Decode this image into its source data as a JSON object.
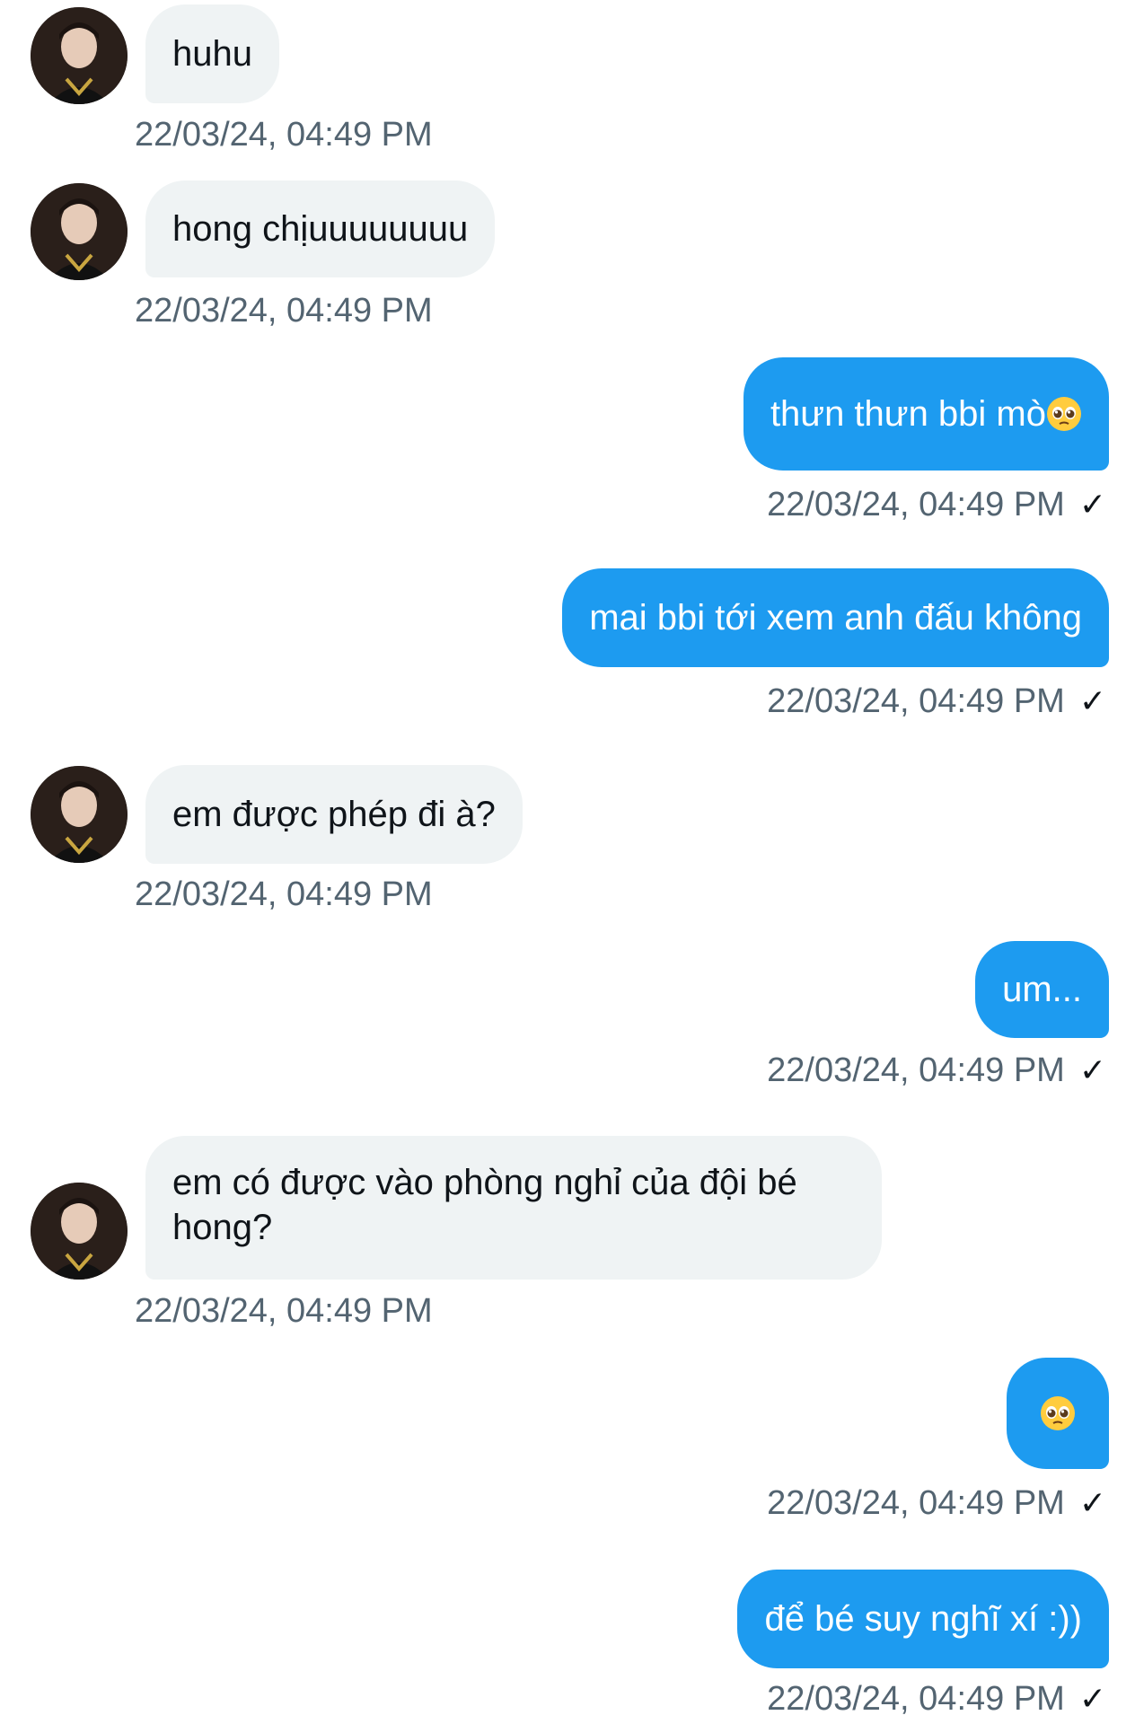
{
  "messages": [
    {
      "side": "in",
      "text": "huhu",
      "time": "22/03/24, 04:49 PM"
    },
    {
      "side": "in",
      "text": "hong chịuuuuuuuu",
      "time": "22/03/24, 04:49 PM"
    },
    {
      "side": "out",
      "text": "thưn thưn bbi mò",
      "emoji": "pleading-face-emoji",
      "time": "22/03/24, 04:49 PM",
      "status": "✓"
    },
    {
      "side": "out",
      "text": "mai bbi tới xem anh đấu không",
      "time": "22/03/24, 04:49 PM",
      "status": "✓"
    },
    {
      "side": "in",
      "text": "em được phép đi à?",
      "time": "22/03/24, 04:49 PM"
    },
    {
      "side": "out",
      "text": "um...",
      "time": "22/03/24, 04:49 PM",
      "status": "✓"
    },
    {
      "side": "in",
      "text": "em có được vào phòng nghỉ của đội bé hong?",
      "time": "22/03/24, 04:49 PM"
    },
    {
      "side": "out",
      "text": "",
      "emoji": "pleading-face-emoji",
      "time": "22/03/24, 04:49 PM",
      "status": "✓"
    },
    {
      "side": "out",
      "text": "để bé suy nghĩ xí :))",
      "time": "22/03/24, 04:49 PM",
      "status": "✓"
    }
  ],
  "colors": {
    "outgoing_bubble": "#1d9bf0",
    "incoming_bubble": "#eff3f4",
    "timestamp": "#536471"
  }
}
